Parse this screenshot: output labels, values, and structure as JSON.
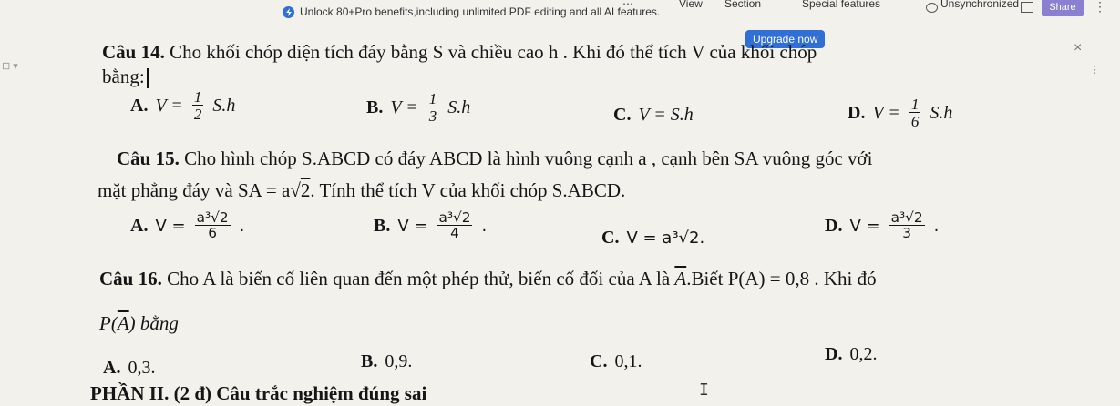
{
  "toolbar": {
    "view": "View",
    "section": "Section",
    "special": "Special features",
    "sync": "Unsynchronized",
    "share": "Share"
  },
  "banner": {
    "text": "Unlock 80+Pro benefits,including unlimited PDF editing and all AI features.",
    "upgrade": "Upgrade now"
  },
  "q14": {
    "label": "Câu 14.",
    "line1": "Cho khối chóp diện tích đáy bằng S và chiều cao h . Khi đó thể tích V của khối chóp",
    "line2": "bằng:",
    "a": {
      "label": "A.",
      "pre": "V =",
      "num": "1",
      "den": "2",
      "post": "S.h"
    },
    "b": {
      "label": "B.",
      "pre": "V =",
      "num": "1",
      "den": "3",
      "post": "S.h"
    },
    "c": {
      "label": "C.",
      "expr": "V = S.h"
    },
    "d": {
      "label": "D.",
      "pre": "V =",
      "num": "1",
      "den": "6",
      "post": "S.h"
    }
  },
  "q15": {
    "label": "Câu 15.",
    "line1": "Cho hình chóp S.ABCD có đáy ABCD là hình vuông cạnh a , cạnh bên SA vuông góc với",
    "line2a": "mặt phẳng đáy và SA = a",
    "line2b": "2",
    "line2c": ". Tính thể tích V của khối chóp S.ABCD.",
    "a": {
      "label": "A.",
      "pre": "V =",
      "num": "a³√2",
      "den": "6",
      "post": "."
    },
    "b": {
      "label": "B.",
      "pre": "V =",
      "num": "a³√2",
      "den": "4",
      "post": "."
    },
    "c": {
      "label": "C.",
      "expr": "V = a³√2."
    },
    "d": {
      "label": "D.",
      "pre": "V =",
      "num": "a³√2",
      "den": "3",
      "post": "."
    }
  },
  "q16": {
    "label": "Câu 16.",
    "line1a": "Cho A là biến cố liên quan đến một phép thử, biến cố đối của A là",
    "line1b": "A",
    "line1c": ".Biết P(A) = 0,8 . Khi đó",
    "line2a": "P(",
    "line2b": "A",
    "line2c": ") bằng",
    "a": {
      "label": "A.",
      "val": "0,3."
    },
    "b": {
      "label": "B.",
      "val": "0,9."
    },
    "c": {
      "label": "C.",
      "val": "0,1."
    },
    "d": {
      "label": "D.",
      "val": "0,2."
    }
  },
  "part2": {
    "title": "PHẦN II. (2 đ) Câu trắc nghiệm đúng sai"
  }
}
